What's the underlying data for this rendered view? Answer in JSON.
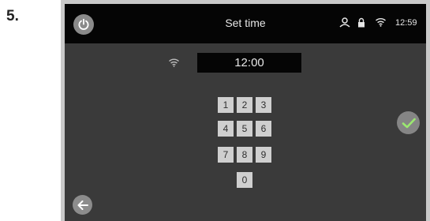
{
  "step": {
    "number": "5."
  },
  "header": {
    "title": "Set time",
    "clock": "12:59"
  },
  "time_field": {
    "value": "12:00"
  },
  "keypad": {
    "keys": [
      "1",
      "2",
      "3",
      "4",
      "5",
      "6",
      "7",
      "8",
      "9",
      "0"
    ]
  },
  "colors": {
    "screen_bg": "#3a3a3a",
    "topbar_bg": "#050505",
    "key_bg": "#cfcfcf",
    "confirm_check": "#9be870"
  },
  "icons": {
    "power": "power-icon",
    "user": "user-icon",
    "lock": "lock-icon",
    "wifi": "wifi-icon",
    "confirm": "checkmark-icon",
    "back": "arrow-left-icon"
  }
}
